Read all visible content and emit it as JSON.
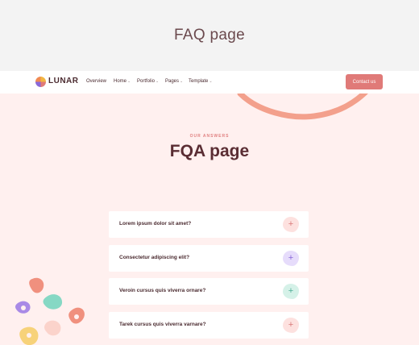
{
  "page_title": "FAQ page",
  "nav": {
    "brand": "LUNAR",
    "items": [
      {
        "label": "Overview",
        "has_menu": false
      },
      {
        "label": "Home",
        "has_menu": true
      },
      {
        "label": "Portfolio",
        "has_menu": true
      },
      {
        "label": "Pages",
        "has_menu": true
      },
      {
        "label": "Template",
        "has_menu": true
      }
    ],
    "cta_label": "Contact us"
  },
  "hero": {
    "eyebrow": "OUR ANSWERS",
    "title": "FQA page"
  },
  "faq": [
    {
      "question": "Lorem ipsum dolor sit amet?",
      "icon": "plus-icon",
      "accent": "#fde1df",
      "icon_color": "#d97a7a"
    },
    {
      "question": "Consectetur adipiscing elit?",
      "icon": "plus-icon",
      "accent": "#e6dcfb",
      "icon_color": "#8a68d8"
    },
    {
      "question": "Veroin cursus quis viverra ornare?",
      "icon": "plus-icon",
      "accent": "#d5f1e8",
      "icon_color": "#4fae96"
    },
    {
      "question": "Tarek cursus quis viverra varnare?",
      "icon": "plus-icon",
      "accent": "#fde1df",
      "icon_color": "#d97a7a"
    }
  ],
  "colors": {
    "accent": "#e07a78",
    "background": "#fff0ef",
    "heading": "#5a2d33"
  }
}
